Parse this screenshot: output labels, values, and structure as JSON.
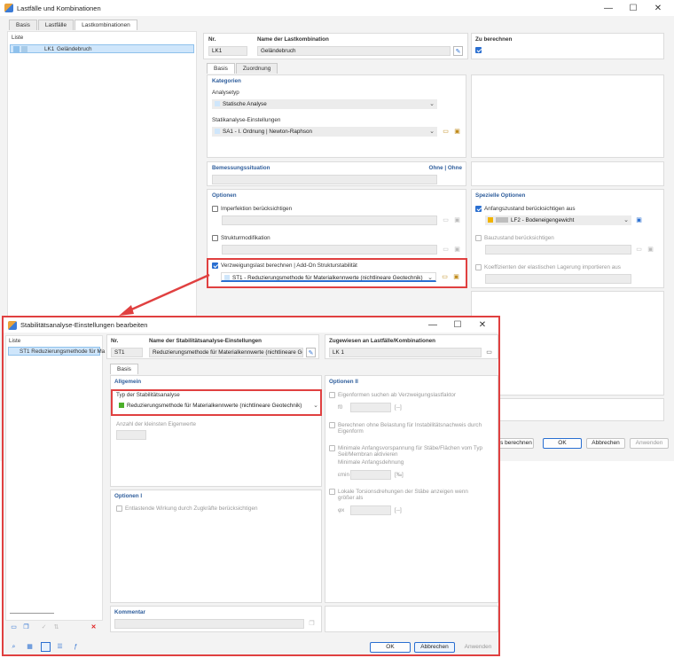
{
  "main": {
    "title": "Lastfälle und Kombinationen",
    "tabs": [
      "Basis",
      "Lastfälle",
      "Lastkombinationen"
    ],
    "list_header": "Liste",
    "list_item": {
      "no": "LK1",
      "name": "Geländebruch"
    },
    "no_label": "Nr.",
    "no_value": "LK1",
    "name_label": "Name der Lastkombination",
    "name_value": "Geländebruch",
    "to_calc_label": "Zu berechnen",
    "inner_tabs": [
      "Basis",
      "Zuordnung"
    ],
    "categories_head": "Kategorien",
    "analysis_type_label": "Analysetyp",
    "analysis_type_value": "Statische Analyse",
    "static_settings_label": "Statikanalyse-Einstellungen",
    "static_settings_value": "SA1 - I. Ordnung | Newton-Raphson",
    "design_situation_label": "Bemessungssituation",
    "design_situation_right": "Ohne | Ohne",
    "options_head": "Optionen",
    "imperfection_label": "Imperfektion berücksichtigen",
    "structure_mod_label": "Strukturmodifikation",
    "buckling_label": "Verzweigungslast berechnen | Add-On Strukturstabilität",
    "buckling_value": "ST1 - Reduzierungsmethode für Materialkennwerte (nichtlineare Geotechnik)",
    "special_options_head": "Spezielle Optionen",
    "initial_state_label": "Anfangszustand berücksichtigen aus",
    "initial_state_value": "LF2 - Bodeneigengewicht",
    "construction_stage_label": "Bauzustand berücksichtigen",
    "elastic_coeff_label": "Koeffizienten der elastischen Lagerung importieren aus",
    "btn_calc": "s berechnen",
    "btn_ok": "OK",
    "btn_cancel": "Abbrechen",
    "btn_apply": "Anwenden"
  },
  "dialog": {
    "title": "Stabilitätsanalyse-Einstellungen bearbeiten",
    "list_header": "Liste",
    "list_item": "ST1  Reduzierungsmethode für Ma",
    "no_label": "Nr.",
    "no_value": "ST1",
    "name_label": "Name der Stabilitätsanalyse-Einstellungen",
    "name_value": "Reduzierungsmethode für Materialkennwerte (nichtlineare Ge",
    "assigned_label": "Zugewiesen an Lastfälle/Kombinationen",
    "assigned_value": "LK 1",
    "tab": "Basis",
    "general_head": "Allgemein",
    "type_label": "Typ der Stabilitätsanalyse",
    "type_value": "Reduzierungsmethode für Materialkennwerte (nichtlineare Geotechnik)",
    "eigen_count_label": "Anzahl der kleinsten Eigenwerte",
    "options1_head": "Optionen I",
    "relieving_label": "Entlastende Wirkung durch Zugkräfte berücksichtigen",
    "options2_head": "Optionen II",
    "opt2_eigen_label": "Eigenformen suchen ab Verzweigungslastfaktor",
    "opt2_f0_label": "f0",
    "opt2_f0_unit": "[--]",
    "opt2_noload_label": "Berechnen ohne Belastung für Instabilitätsnachweis durch Eigenform",
    "opt2_prestress_label": "Minimale Anfangsvorspannung für Stäbe/Flächen vom Typ Seil/Membran aktivieren",
    "opt2_min_strain_label": "Minimale Anfangsdehnung",
    "opt2_emin_label": "εmin",
    "opt2_emin_unit": "[‰]",
    "opt2_torsion_label": "Lokale Torsionsdrehungen der Stäbe anzeigen wenn größer als",
    "opt2_phi_label": "φx",
    "opt2_phi_unit": "[--]",
    "comment_head": "Kommentar",
    "btn_ok": "OK",
    "btn_cancel": "Abbrechen",
    "btn_apply": "Anwenden"
  },
  "colors": {
    "accent": "#2a6fd1",
    "highlight": "#e04040",
    "header_blue": "#2f5e9c"
  }
}
